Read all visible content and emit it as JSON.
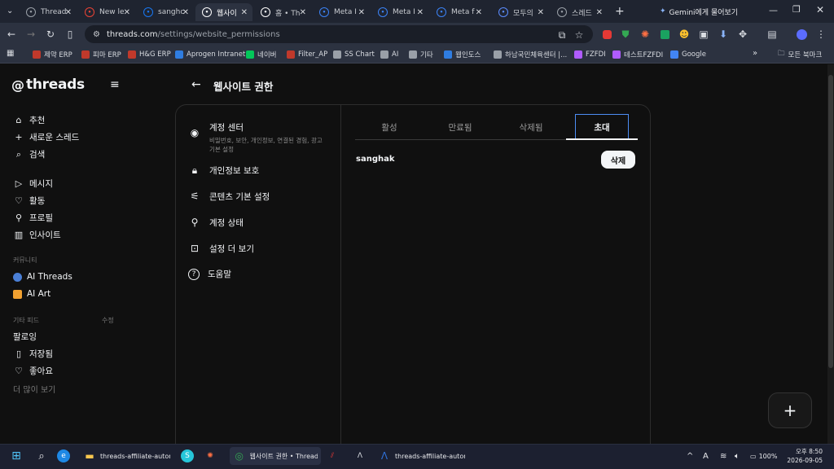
{
  "browser": {
    "tabs": [
      {
        "title": "Thread",
        "icon": "globe-icon",
        "color": "#9aa0a8"
      },
      {
        "title": "New le",
        "icon": "gmail-icon",
        "color": "#ea4335"
      },
      {
        "title": "sanghc",
        "icon": "facebook-icon",
        "color": "#1877f2"
      },
      {
        "title": "웹사이",
        "icon": "threads-icon",
        "color": "#ffffff"
      },
      {
        "title": "홈 • Th",
        "icon": "threads-icon",
        "color": "#ffffff"
      },
      {
        "title": "Meta I",
        "icon": "meta-icon",
        "color": "#3b82f6"
      },
      {
        "title": "Meta I",
        "icon": "meta-icon",
        "color": "#3b82f6"
      },
      {
        "title": "Meta f",
        "icon": "meta-icon",
        "color": "#3b82f6"
      },
      {
        "title": "모두의",
        "icon": "ai-icon",
        "color": "#5b8cff"
      },
      {
        "title": "스레드",
        "icon": "globe-icon",
        "color": "#9aa0a8"
      }
    ],
    "gemini_label": "Gemini에게 물어보기",
    "url_host": "threads.com",
    "url_path": "/settings/website_permissions",
    "bookmarks": [
      {
        "label": "제약 ERP",
        "color": "#c0392b"
      },
      {
        "label": "피마 ERP",
        "color": "#c0392b"
      },
      {
        "label": "H&G ERP",
        "color": "#c0392b"
      },
      {
        "label": "Aprogen Intranet",
        "color": "#2f7de1"
      },
      {
        "label": "네이버",
        "color": "#03c75a"
      },
      {
        "label": "Filter_AP",
        "color": "#c0392b"
      },
      {
        "label": "SS Chart",
        "color": "#9aa0a8"
      },
      {
        "label": "AI",
        "color": "#9aa0a8"
      },
      {
        "label": "기타",
        "color": "#9aa0a8"
      },
      {
        "label": "웹인도스",
        "color": "#2f7de1"
      },
      {
        "label": "하남국민체육센터 |...",
        "color": "#9aa0a8"
      },
      {
        "label": "FZFDI",
        "color": "#b05cff"
      },
      {
        "label": "테스트FZFDI",
        "color": "#b05cff"
      },
      {
        "label": "Google",
        "color": "#4285f4"
      }
    ],
    "all_bookmarks": "모든 북마크"
  },
  "sidebar": {
    "logo": "threads",
    "nav_main": [
      "추천",
      "새로운 스레드",
      "검색"
    ],
    "nav_second": [
      "메시지",
      "활동",
      "프로필",
      "인사이트"
    ],
    "community_heading": "커뮤니티",
    "communities": [
      "AI Threads",
      "AI Art"
    ],
    "feeds_heading": "기타 피드",
    "feeds_edit": "수정",
    "feeds": [
      "팔로잉",
      "저장됨",
      "좋아요"
    ],
    "more": "더 많이 보기"
  },
  "header": {
    "title": "웹사이트 권한"
  },
  "settings_menu": [
    {
      "label": "계정 센터",
      "sub": "비밀번호, 보안, 개인정보, 연결된 경험, 광고 기본 설정",
      "icon": "account-circle-icon"
    },
    {
      "label": "개인정보 보호",
      "icon": "lock-icon"
    },
    {
      "label": "콘텐츠 기본 설정",
      "icon": "sliders-icon"
    },
    {
      "label": "계정 상태",
      "icon": "person-icon"
    },
    {
      "label": "설정 더 보기",
      "icon": "more-settings-icon"
    },
    {
      "label": "도움말",
      "icon": "help-icon"
    }
  ],
  "permission_tabs": [
    {
      "label": "활성",
      "selected": false
    },
    {
      "label": "만료됨",
      "selected": false
    },
    {
      "label": "삭제됨",
      "selected": false
    },
    {
      "label": "초대",
      "selected": true
    }
  ],
  "invites": [
    {
      "name": "sanghak",
      "action": "삭제"
    }
  ],
  "taskbar": {
    "apps": [
      {
        "label": "threads-affiliate-automa",
        "icon": "folder-icon"
      },
      {
        "label": "웹사이트 권한 • Threads",
        "icon": "chrome-icon"
      },
      {
        "label": "threads-affiliate-automa",
        "icon": "terminal-icon"
      }
    ],
    "battery": "100%",
    "time": "오후 8:50",
    "date": "2026-09-05"
  }
}
